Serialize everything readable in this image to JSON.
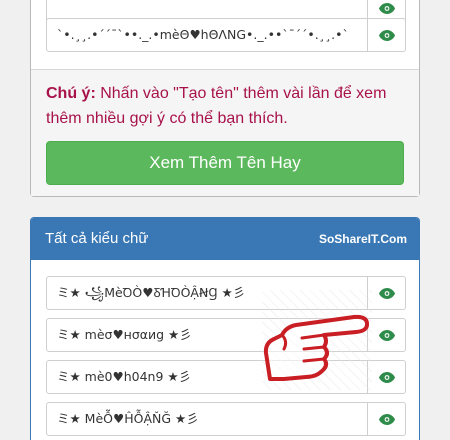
{
  "top_rows": [
    {
      "text": ""
    },
    {
      "text": "`•.¸¸.•´´¯`••._.•mèΘ♥hΘΛΝG•._.••`¯´´•.¸¸.•`"
    }
  ],
  "note": {
    "prefix": "Chú ý:",
    "body": " Nhấn vào \"Tạo tên\" thêm vài lần để xem thêm nhiều gợi ý có thể bạn thích."
  },
  "more_button": "Xem Thêm Tên Hay",
  "styles_panel": {
    "title": "Tất cả kiểu chữ",
    "brand": "SoShareIT.Com",
    "rows": [
      {
        "text": "ミ★ ꧁MèꝹÒ♥ꝽꞪꝹÒẬꞤꞬ ★彡"
      },
      {
        "text": "ミ★ mèσ♥нσαиg ★彡"
      },
      {
        "text": "ミ★ mè0♥h04n9 ★彡"
      },
      {
        "text": "ミ★ MèỖ♥ĤỖẬŇĞ ★彡"
      }
    ]
  },
  "colors": {
    "accent": "#3a78b5",
    "button": "#5cb85c",
    "note": "#a8124a",
    "eye": "#2e8b4a",
    "hand": "#c81e24"
  }
}
